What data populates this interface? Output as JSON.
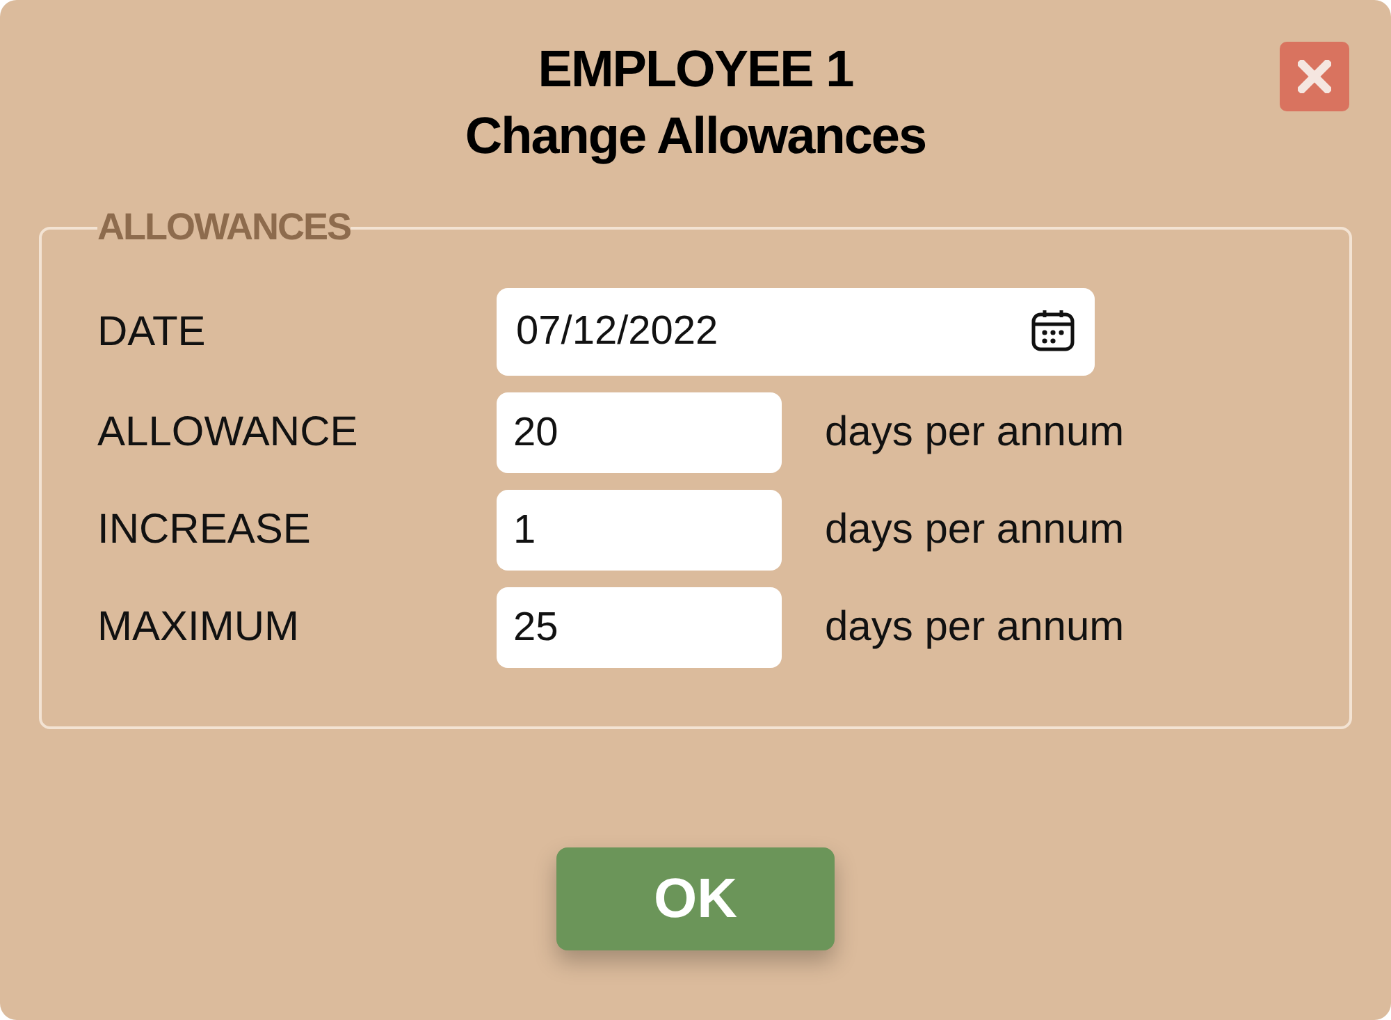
{
  "dialog": {
    "title_lines": [
      "EMPLOYEE 1",
      "Change Allowances"
    ],
    "group": {
      "legend": "ALLOWANCES",
      "fields": [
        {
          "kind": "date",
          "label": "DATE",
          "value": "07/12/2022"
        },
        {
          "kind": "number",
          "label": "ALLOWANCE",
          "value": "20",
          "unit": "days per annum"
        },
        {
          "kind": "number",
          "label": "INCREASE",
          "value": "1",
          "unit": "days per annum"
        },
        {
          "kind": "number",
          "label": "MAXIMUM",
          "value": "25",
          "unit": "days per annum"
        }
      ]
    },
    "ok_button": "OK"
  }
}
